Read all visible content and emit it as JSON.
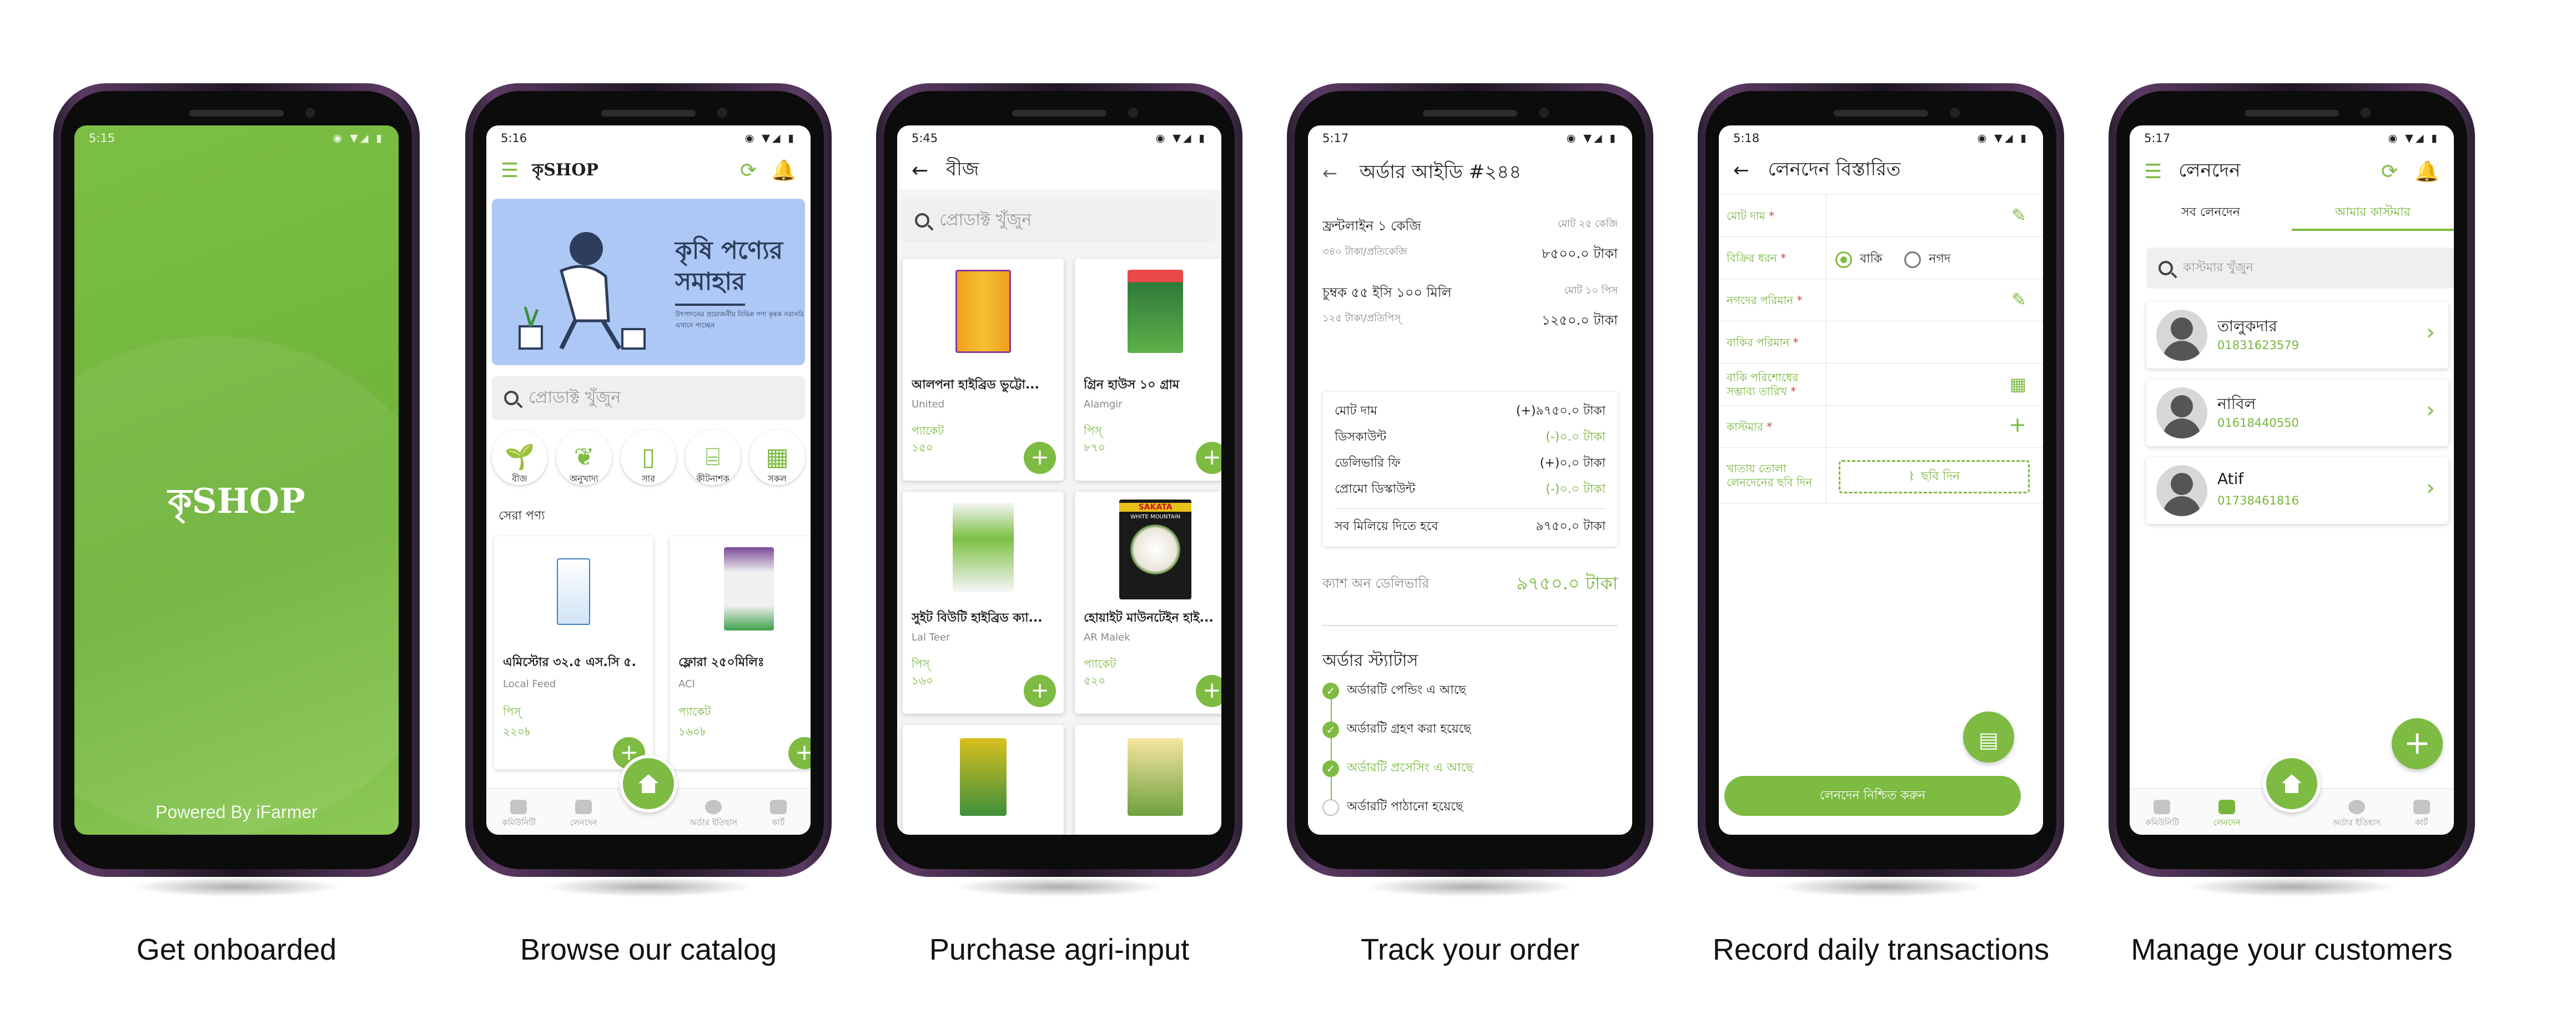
{
  "brand": {
    "name": "কৃSHOP",
    "green": "#7dbb42",
    "splash": "#6fb33a"
  },
  "captions": [
    "Get onboarded",
    "Browse our catalog",
    "Purchase agri-input",
    "Track your order",
    "Record daily transactions",
    "Manage your customers"
  ],
  "splash": {
    "time": "5:15",
    "powered": "Powered By iFarmer"
  },
  "catalog": {
    "time": "5:16",
    "banner": {
      "title_line1": "কৃষি পণ্যের",
      "title_line2": "সমাহার",
      "sub": "উৎপাদনের প্রয়োজনীয় বিভিন্ন পণ্য কৃষক সরাসরি এখানে পাচ্ছেন"
    },
    "search_placeholder": "প্রোডাক্ট খুঁজুন",
    "categories": [
      "বীজ",
      "অনুখাদ্য",
      "সার",
      "কীটনাশক",
      "সকল"
    ],
    "section": "সেরা পণ্য",
    "products": [
      {
        "name": "এমিস্টোর ৩২.৫ এস.সি ৫...",
        "brand": "Local Feed",
        "unit": "পিস্",
        "price": "২২০৳"
      },
      {
        "name": "ফ্লোরা ২৫০মিলিঃ",
        "brand": "ACI",
        "unit": "প্যাকেট",
        "price": "১৬০৳"
      }
    ],
    "nav": [
      "কমিউনিটি",
      "লেনদেন",
      "",
      "অর্ডার ইতিহাস",
      "কার্ট"
    ]
  },
  "purchase": {
    "time": "5:45",
    "title": "বীজ",
    "search_placeholder": "প্রোডাক্ট খুঁজুন",
    "products": [
      {
        "name": "আলপনা হাইব্রিড ভুট্টো...",
        "brand": "United",
        "unit": "প্যাকেট",
        "price": "১৫০"
      },
      {
        "name": "গ্রিন হাউস ১০ গ্রাম",
        "brand": "Alamgir",
        "unit": "পিস্",
        "price": "৮৭০"
      },
      {
        "name": "সুইট বিউটি হাইব্রিড ক্যা...",
        "brand": "Lal Teer",
        "unit": "পিস্",
        "price": "১৬০"
      },
      {
        "name": "হোয়াইট মাউনটেইন হাই...",
        "brand": "AR Malek",
        "unit": "প্যাকেট",
        "price": "৫২০"
      }
    ],
    "img_label": "WHITE MOUNTAIN",
    "img_brand": "SAKATA"
  },
  "order": {
    "time": "5:17",
    "title": "অর্ডার আইডি #২৪৪",
    "items": [
      {
        "name": "ফ্রন্টলাইন ১ কেজি",
        "qty": "মোট ২৫ কেজি",
        "rate": "৩৪০ টাকা/প্রতিকেজি",
        "total": "৮৫০০.০ টাকা"
      },
      {
        "name": "চুম্বক ৫৫ ইসি ১০০ মিলি",
        "qty": "মোট ১০ পিস",
        "rate": "১২৫ টাকা/প্রতিপিস্",
        "total": "১২৫০.০ টাকা"
      }
    ],
    "summary": [
      {
        "label": "মোট দাম",
        "value": "(+)৯৭৫০.০ টাকা"
      },
      {
        "label": "ডিসকাউন্ট",
        "value": "(-)০.০ টাকা"
      },
      {
        "label": "ডেলিভারি ফি",
        "value": "(+)০.০ টাকা"
      },
      {
        "label": "প্রোমো ডিস্কাউন্ট",
        "value": "(-)০.০ টাকা"
      }
    ],
    "grand_label": "সব মিলিয়ে দিতে হবে",
    "grand_value": "৯৭৫০.০ টাকা",
    "cod_label": "ক্যাশ অন ডেলিভারি",
    "cod_value": "৯৭৫০.০ টাকা",
    "status_title": "অর্ডার স্ট্যাটাস",
    "statuses": [
      "অর্ডারটি পেন্ডিং এ আছে",
      "অর্ডারটি গ্রহণ করা হয়েছে",
      "অর্ডারটি প্রসেসিং এ আছে",
      "অর্ডারটি পাঠানো হয়েছে"
    ]
  },
  "txn": {
    "time": "5:18",
    "title": "লেনদেন বিস্তারিত",
    "fields": [
      "মোট দাম",
      "বিক্রির ধরন",
      "নগদের পরিমান",
      "বাকির পরিমান",
      "বাকি পরিশোধের সম্ভাব্য তারিখ",
      "কাস্টমার",
      "খাতায় তোলা লেনদেনের ছবি দিন"
    ],
    "radio": [
      "বাকি",
      "নগদ"
    ],
    "photo_btn": "ছবি দিন",
    "confirm": "লেনদেন নিশ্চিত করুন"
  },
  "customers": {
    "time": "5:17",
    "title": "লেনদেন",
    "tabs": [
      "সব লেনদেন",
      "আমার কাস্টমার"
    ],
    "search_placeholder": "কাস্টমার খুঁজুন",
    "list": [
      {
        "name": "তালুকদার",
        "phone": "01831623579"
      },
      {
        "name": "নাবিল",
        "phone": "01618440550"
      },
      {
        "name": "Atif",
        "phone": "01738461816"
      }
    ],
    "nav": [
      "কমিউনিটি",
      "লেনদেন",
      "",
      "অর্ডার ইতিহাস",
      "কার্ট"
    ]
  }
}
